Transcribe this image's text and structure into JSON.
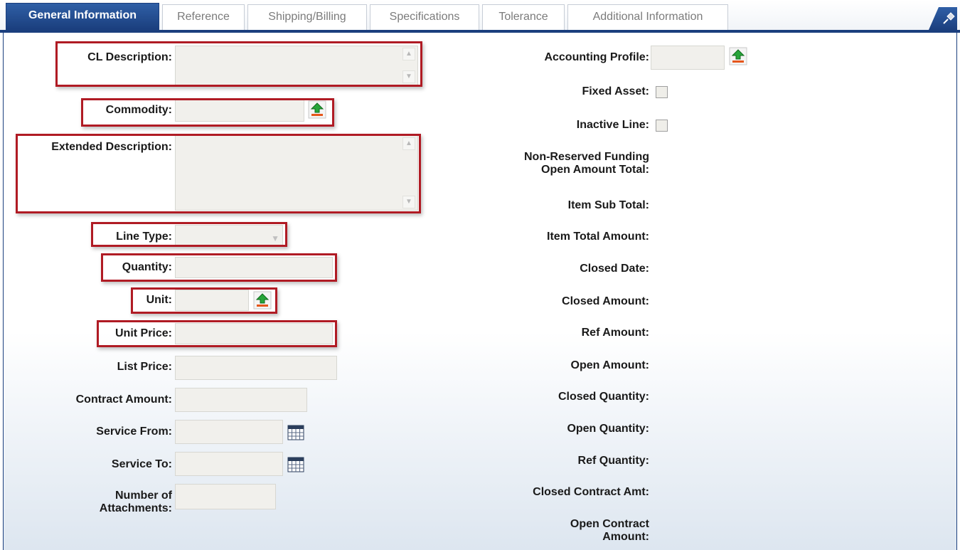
{
  "tabs": [
    {
      "label": "General Information",
      "active": true
    },
    {
      "label": "Reference"
    },
    {
      "label": "Shipping/Billing"
    },
    {
      "label": "Specifications"
    },
    {
      "label": "Tolerance"
    },
    {
      "label": "Additional Information"
    }
  ],
  "left_fields": {
    "cl_description": {
      "label": "CL Description:",
      "value": ""
    },
    "commodity": {
      "label": "Commodity:",
      "value": ""
    },
    "extended_description": {
      "label": "Extended Description:",
      "value": ""
    },
    "line_type": {
      "label": "Line Type:",
      "value": ""
    },
    "quantity": {
      "label": "Quantity:",
      "value": ""
    },
    "unit": {
      "label": "Unit:",
      "value": ""
    },
    "unit_price": {
      "label": "Unit Price:",
      "value": ""
    },
    "list_price": {
      "label": "List Price:",
      "value": ""
    },
    "contract_amount": {
      "label": "Contract Amount:",
      "value": ""
    },
    "service_from": {
      "label": "Service From:",
      "value": ""
    },
    "service_to": {
      "label": "Service To:",
      "value": ""
    },
    "number_of_attachments": {
      "label_line1": "Number of",
      "label_line2": "Attachments:",
      "value": ""
    }
  },
  "right_fields": {
    "accounting_profile": {
      "label": "Accounting Profile:",
      "value": ""
    },
    "fixed_asset": {
      "label": "Fixed Asset:",
      "checked": false
    },
    "inactive_line": {
      "label": "Inactive Line:",
      "checked": false
    },
    "non_reserved_funding": {
      "label_line1": "Non-Reserved Funding",
      "label_line2": "Open Amount Total:"
    },
    "item_sub_total": {
      "label": "Item Sub Total:"
    },
    "item_total_amount": {
      "label": "Item Total Amount:"
    },
    "closed_date": {
      "label": "Closed Date:"
    },
    "closed_amount": {
      "label": "Closed Amount:"
    },
    "ref_amount": {
      "label": "Ref Amount:"
    },
    "open_amount": {
      "label": "Open Amount:"
    },
    "closed_quantity": {
      "label": "Closed Quantity:"
    },
    "open_quantity": {
      "label": "Open Quantity:"
    },
    "ref_quantity": {
      "label": "Ref Quantity:"
    },
    "closed_contract_amt": {
      "label": "Closed Contract Amt:"
    },
    "open_contract_amount": {
      "label_line1": "Open Contract",
      "label_line2": "Amount:"
    }
  },
  "icons": {
    "lookup": "upload-arrow-icon",
    "calendar": "calendar-icon",
    "pin": "pin-icon"
  },
  "colors": {
    "tab_active": "#1b3f7e",
    "highlight": "#b01b24",
    "field_bg": "#f1f0ec"
  }
}
